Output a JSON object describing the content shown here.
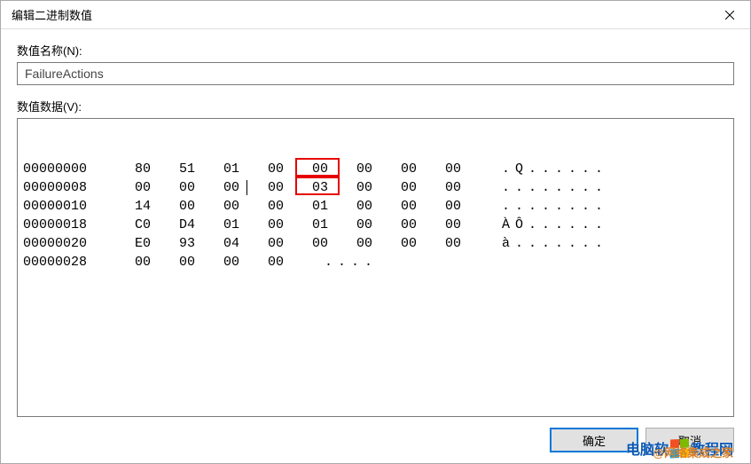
{
  "window": {
    "title": "编辑二进制数值"
  },
  "labels": {
    "value_name": "数值名称(N):",
    "value_data": "数值数据(V):"
  },
  "value_name": "FailureActions",
  "hex_rows": [
    {
      "offset": "00000000",
      "bytes": [
        "80",
        "51",
        "01",
        "00",
        "00",
        "00",
        "00",
        "00"
      ],
      "ascii": ".Q......"
    },
    {
      "offset": "00000008",
      "bytes": [
        "00",
        "00",
        "00",
        "00",
        "03",
        "00",
        "00",
        "00"
      ],
      "ascii": "........"
    },
    {
      "offset": "00000010",
      "bytes": [
        "14",
        "00",
        "00",
        "00",
        "01",
        "00",
        "00",
        "00"
      ],
      "ascii": "........"
    },
    {
      "offset": "00000018",
      "bytes": [
        "C0",
        "D4",
        "01",
        "00",
        "01",
        "00",
        "00",
        "00"
      ],
      "ascii": "ÀÔ......"
    },
    {
      "offset": "00000020",
      "bytes": [
        "E0",
        "93",
        "04",
        "00",
        "00",
        "00",
        "00",
        "00"
      ],
      "ascii": "à......."
    },
    {
      "offset": "00000028",
      "bytes": [
        "00",
        "00",
        "00",
        "00"
      ],
      "ascii": "...."
    }
  ],
  "buttons": {
    "ok": "确定",
    "cancel": "取消"
  },
  "watermark": {
    "left": "电脑软",
    "right": "教程网",
    "sub": "@网络集成之家"
  }
}
